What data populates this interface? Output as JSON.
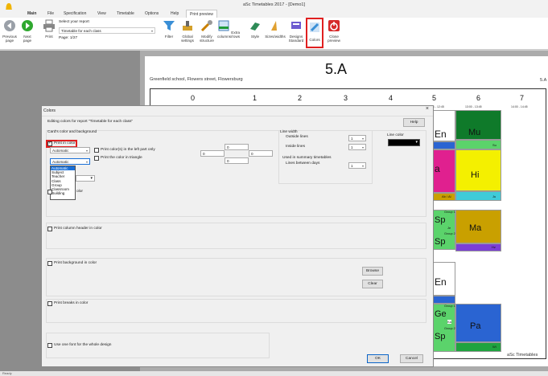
{
  "window": {
    "title": "aSc Timetables 2017 - [Demo1]"
  },
  "menu": {
    "items": [
      "Main",
      "File",
      "Specification",
      "View",
      "Timetable",
      "Options",
      "Help",
      "Print preview"
    ],
    "active": "Print preview"
  },
  "ribbon": {
    "previous": "Previous page",
    "next": "Next page",
    "print": "Print",
    "report_label": "Select your report",
    "report_value": "Timetable for each class",
    "page": "Page: 1/27",
    "filter": "Filter",
    "global": "Global settings",
    "modify": "Modify structure",
    "extra": "Extra columns/rows",
    "style": "Style",
    "sizes": "Sizes/widths",
    "designs": "Designs Standard",
    "colors": "Colors",
    "close": "Close preview"
  },
  "preview": {
    "class_title": "5.A",
    "school": "Greenfield school, Flowers street, Flowersburg",
    "class_right": "5.A",
    "periods": [
      "0",
      "1",
      "2",
      "3",
      "4",
      "5",
      "6",
      "7"
    ],
    "times": {
      "p5": "1 - 12:45",
      "p6": "13:00 - 13:45",
      "p7": "14:00 - 14:45"
    },
    "cells": [
      {
        "subj": "En",
        "sub": ""
      },
      {
        "subj": "Mu",
        "sub": "Su"
      },
      {
        "subj": "a",
        "sub": "Ab / Al"
      },
      {
        "subj": "Hi",
        "sub": "Ju"
      },
      {
        "subj": "Sp",
        "g1": "Group 1",
        "t1": "Je",
        "g2": "Group 2",
        "s2": "Sp"
      },
      {
        "subj": "Ma",
        "sub": "Hz"
      },
      {
        "subj": "En",
        "sub": ""
      },
      {
        "subj": "Ge",
        "g1": "Group 1",
        "t1": "Ka",
        "g2": "Group 2",
        "s2": "Sp"
      },
      {
        "subj": "Pa",
        "sub": "Wi"
      }
    ],
    "footer": "aSc Timetables"
  },
  "dialog": {
    "title": "Colors",
    "close": "×",
    "editing": "Editing colors for report \"Timetable for each class\"",
    "help": "Help",
    "card_heading": "Card's color and background",
    "print_in_color": "Print in color",
    "select1": "Automatic",
    "select2": "Automatic",
    "left_part": "Print color(s) in the left part only",
    "triangle": "Print the color in triangle",
    "options": [
      "Automatic",
      "Subject",
      "Teacher",
      "Class",
      "Group",
      "Classroom",
      "Building"
    ],
    "nums": [
      "0",
      "0",
      "0",
      "0"
    ],
    "hidden_label": "olor",
    "line_width": "Line width",
    "outside": "Outside lines",
    "inside": "Inside lines",
    "outside_val": "1",
    "inside_val": "1",
    "summary": "Used in summary timetables",
    "between_days": "Lines between days",
    "between_val": "1",
    "line_color": "Line color",
    "col_header": "Print column header in color",
    "background": "Print background in color",
    "browse": "Browse",
    "clear": "Clear",
    "breaks": "Print breaks in color",
    "one_font": "Use one font for the whole design",
    "ok": "OK",
    "cancel": "Cancel"
  },
  "status": "Ready",
  "colors": {
    "accent": "#e02020",
    "lightgreen": "#5bd36b",
    "olive": "#c9a000",
    "magenta": "#e0208f",
    "blue": "#2a64d2",
    "yellow": "#f4f000",
    "cyan": "#3fcbd9"
  }
}
